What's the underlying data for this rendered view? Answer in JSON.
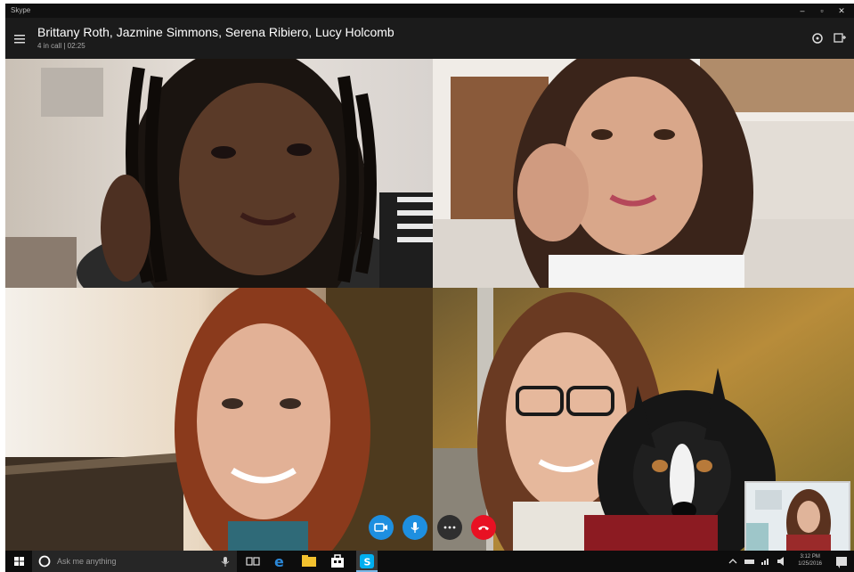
{
  "window": {
    "app_name": "Skype",
    "controls": [
      "minimize",
      "maximize",
      "close"
    ]
  },
  "call_header": {
    "title": "Brittany Roth, Jazmine Simmons, Serena Ribiero, Lucy Holcomb",
    "subtitle": "4 in call | 02:25"
  },
  "icons": {
    "menu": "hamburger-icon",
    "header_right": [
      "dial-pad-icon",
      "add-participant-icon"
    ],
    "controls": [
      "video-camera-icon",
      "microphone-icon",
      "more-options-icon",
      "end-call-icon"
    ]
  },
  "call_controls": [
    {
      "name": "video",
      "color": "#1e8fe0"
    },
    {
      "name": "mute",
      "color": "#1e8fe0"
    },
    {
      "name": "more",
      "color": "#2f2f2f"
    },
    {
      "name": "hangup",
      "color": "#e81123"
    }
  ],
  "taskbar": {
    "search_placeholder": "Ask me anything",
    "clock_time": "3:12 PM",
    "clock_date": "1/25/2016"
  },
  "colors": {
    "accent": "#1e8fe0",
    "hangup": "#e81123",
    "header_bg": "#1b1b1b",
    "taskbar_bg": "#0d0d0d"
  }
}
